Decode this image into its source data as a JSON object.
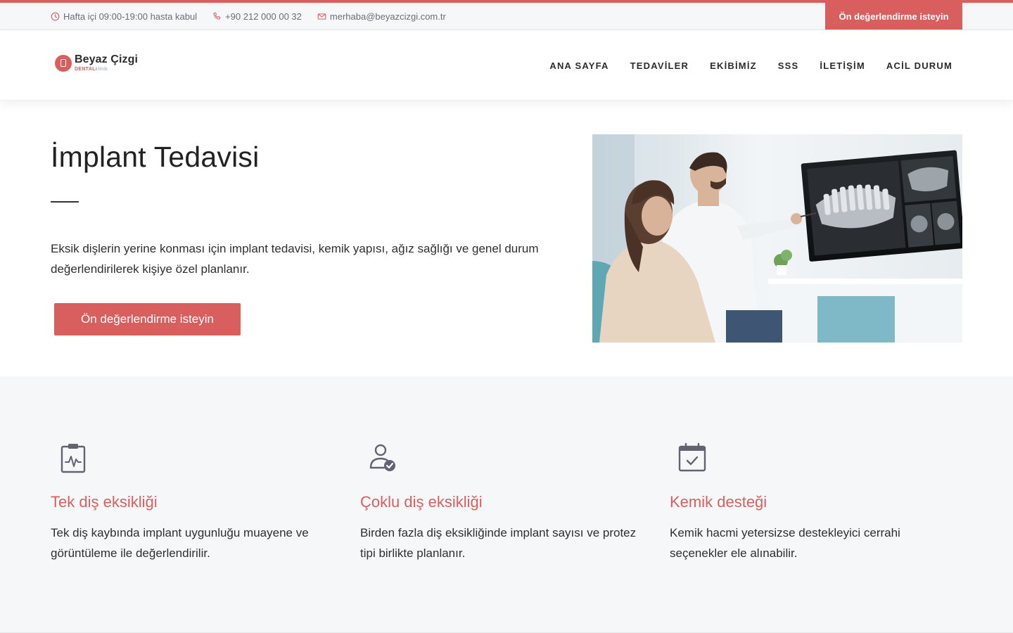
{
  "topbar": {
    "hours": "Hafta içi 09:00-19:00 hasta kabul",
    "phone": "+90 212 000 00 32",
    "email": "merhaba@beyazcizgi.com.tr",
    "cta_label": "Ön değerlendirme isteyin",
    "hours_icon": "clock-icon",
    "phone_icon": "phone-icon",
    "email_icon": "mail-icon"
  },
  "brand": {
    "name": "Beyaz Çizgi",
    "sub_accent": "DENTAL",
    "sub_rest": "klinik",
    "logo_icon": "tooth-icon"
  },
  "nav": {
    "items": [
      "ANA SAYFA",
      "TEDAVİLER",
      "EKİBİMİZ",
      "SSS",
      "İLETİŞİM",
      "ACİL DURUM"
    ]
  },
  "hero": {
    "title": "İmplant Tedavisi",
    "description": "Eksik dişlerin yerine konması için implant tedavisi, kemik yapısı, ağız sağlığı ve genel durum değerlendirilerek kişiye özel planlanır.",
    "cta_label": "Ön değerlendirme isteyin"
  },
  "features": [
    {
      "icon": "clipboard-pulse-icon",
      "title": "Tek diş eksikliği",
      "text": "Tek diş kaybında implant uygunluğu muayene ve görüntüleme ile değerlendirilir."
    },
    {
      "icon": "user-check-icon",
      "title": "Çoklu diş eksikliği",
      "text": "Birden fazla diş eksikliğinde implant sayısı ve protez tipi birlikte planlanır."
    },
    {
      "icon": "calendar-check-icon",
      "title": "Kemik desteği",
      "text": "Kemik hacmi yetersizse destekleyici cerrahi seçenekler ele alınabilir."
    }
  ],
  "colors": {
    "accent": "#d95f5f",
    "icon": "#5f6470",
    "topbar_bg": "#f5f7f8",
    "section_bg": "#f6f7f9"
  }
}
